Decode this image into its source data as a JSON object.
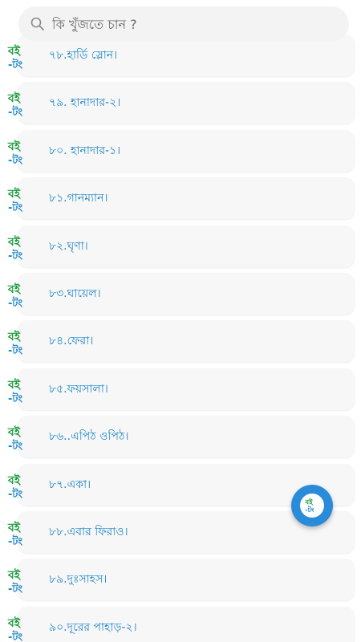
{
  "search": {
    "placeholder": "কি খুঁজতে চান ?",
    "icon": "search-icon"
  },
  "logo": {
    "icon": "boi-tong-logo-icon",
    "text_top": "বই",
    "text_bottom": "-টং",
    "colors": {
      "top": "#1a9a3c",
      "bottom": "#1f86c6"
    }
  },
  "fab": {
    "icon": "boi-tong-logo-icon",
    "color": "#2a8bd9"
  },
  "accent_color": "#1f86c6",
  "items": [
    {
      "label": "৭৮.হার্ডি স্লোন।"
    },
    {
      "label": "৭৯. হানাদার-২।"
    },
    {
      "label": "৮০. হানাদার-১।"
    },
    {
      "label": "৮১.গানম্যান।"
    },
    {
      "label": "৮২.ঘৃণা।"
    },
    {
      "label": "৮৩.ঘায়েল।"
    },
    {
      "label": "৮৪.ফেরা।"
    },
    {
      "label": "৮৫.ফয়সালা।"
    },
    {
      "label": "৮৬..এপিঠ ওপিঠ।"
    },
    {
      "label": "৮৭.একা।"
    },
    {
      "label": "৮৮.এবার ফিরাও।"
    },
    {
      "label": "৮৯.দুঃসাহস।"
    },
    {
      "label": "৯০.দূরের পাহাড়-২।"
    }
  ]
}
